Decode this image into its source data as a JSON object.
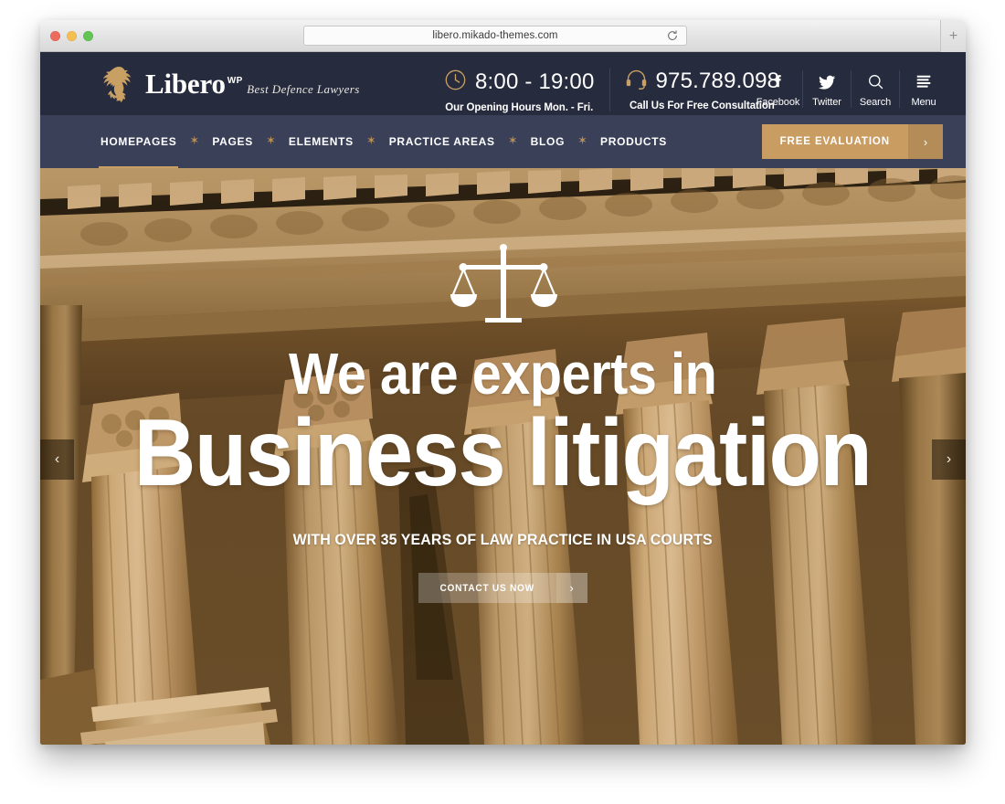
{
  "browser": {
    "url": "libero.mikado-themes.com",
    "reload_icon": "reload-icon",
    "new_tab_label": "+",
    "traffic_lights": [
      "close",
      "minimize",
      "maximize"
    ]
  },
  "site": {
    "logo": {
      "name": "Libero",
      "superscript": "WP",
      "tagline": "Best Defence Lawyers",
      "mark_icon": "griffin-crest-icon"
    },
    "header_info": [
      {
        "icon": "clock-icon",
        "value": "8:00 - 19:00",
        "label": "Our Opening Hours Mon. - Fri."
      },
      {
        "icon": "headset-icon",
        "value": "975.789.098",
        "label": "Call Us For Free Consultation"
      }
    ],
    "header_actions": [
      {
        "icon": "facebook-icon",
        "label": "Facebook"
      },
      {
        "icon": "twitter-icon",
        "label": "Twitter"
      },
      {
        "icon": "search-icon",
        "label": "Search"
      },
      {
        "icon": "hamburger-menu-icon",
        "label": "Menu"
      }
    ],
    "nav": {
      "separator": "✶",
      "items": [
        {
          "label": "HOMEPAGES",
          "active": true
        },
        {
          "label": "PAGES",
          "active": false
        },
        {
          "label": "ELEMENTS",
          "active": false
        },
        {
          "label": "PRACTICE AREAS",
          "active": false
        },
        {
          "label": "BLOG",
          "active": false
        },
        {
          "label": "PRODUCTS",
          "active": false
        }
      ],
      "cta": {
        "label": "FREE EVALUATION",
        "arrow": "›"
      }
    },
    "hero": {
      "icon": "scales-of-justice-icon",
      "line1": "We are experts in",
      "line2": "Business litigation",
      "subtitle": "WITH OVER 35 YEARS OF LAW PRACTICE IN USA COURTS",
      "cta": {
        "label": "CONTACT US NOW",
        "arrow": "›"
      },
      "prev_arrow": "‹",
      "next_arrow": "›",
      "background_alt": "Sepia-toned photograph of a neoclassical courthouse facade with Corinthian columns"
    }
  },
  "colors": {
    "header_bg": "#262b3d",
    "nav_bg": "#3a4058",
    "gold": "#c9a063",
    "gold_button": "#c99c62",
    "hero_sepia": "#9a7440",
    "text_white": "#ffffff"
  }
}
